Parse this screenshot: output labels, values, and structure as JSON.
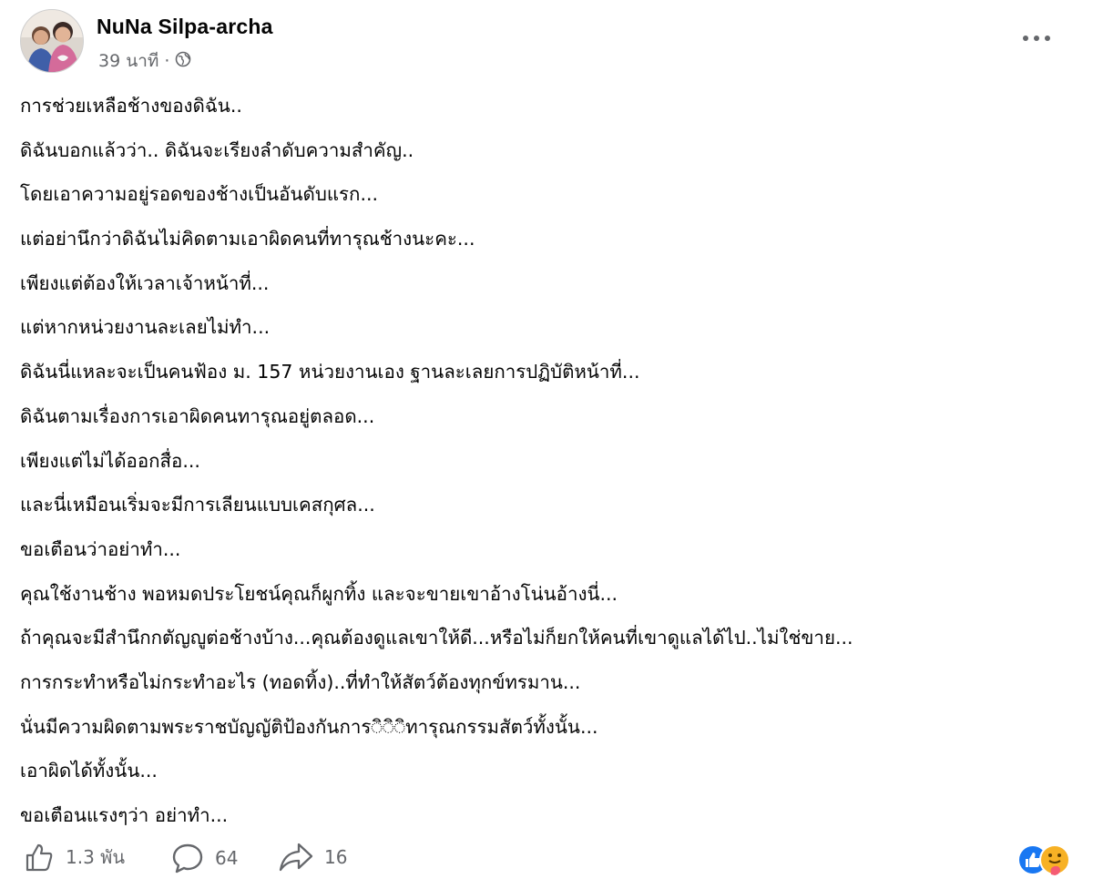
{
  "post": {
    "author": "NuNa Silpa-archa",
    "time": "39 นาที",
    "separator": "·",
    "privacy_icon": "globe-icon",
    "more_icon": "more-options-icon",
    "lines": [
      "การช่วยเหลือช้างของดิฉัน..",
      "ดิฉันบอกแล้วว่า.. ดิฉันจะเรียงลำดับความสำคัญ..",
      "โดยเอาความอยู่รอดของช้างเป็นอันดับแรก...",
      "แต่อย่านึกว่าดิฉันไม่คิดตามเอาผิดคนที่ทารุณช้างนะคะ...",
      "เพียงแต่ต้องให้เวลาเจ้าหน้าที่...",
      "แต่หากหน่วยงานละเลยไม่ทำ...",
      "ดิฉันนี่แหละจะเป็นคนฟ้อง ม. 157 หน่วยงานเอง ฐานละเลยการปฏิบัติหน้าที่...",
      "ดิฉันตามเรื่องการเอาผิดคนทารุณอยู่ตลอด...",
      "เพียงแต่ไม่ได้ออกสื่อ...",
      "และนี่เหมือนเริ่มจะมีการเลียนแบบเคสกุศล...",
      "ขอเตือนว่าอย่าทำ...",
      "คุณใช้งานช้าง พอหมดประโยชน์คุณก็ผูกทิ้ง และจะขายเขาอ้างโน่นอ้างนี่...",
      "ถ้าคุณจะมีสำนึกกตัญญูต่อช้างบ้าง...คุณต้องดูแลเขาให้ดี...หรือไม่ก็ยกให้คนที่เขาดูแลได้ไป..ไม่ใช่ขาย...",
      "การกระทำหรือไม่กระทำอะไร (ทอดทิ้ง)..ที่ทำให้สัตว์ต้องทุกข์ทรมาน...",
      "นั่นมีความผิดตามพระราชบัญญัติป้องกันการ◌ิ◌ิ◌ิทารุณกรรมสัตว์ทั้งนั้น...",
      "เอาผิดได้ทั้งนั้น...",
      "ขอเตือนแรงๆว่า อย่าทำ..."
    ]
  },
  "footer": {
    "like_icon": "thumbs-up-icon",
    "like_count": "1.3 พัน",
    "comment_icon": "comment-icon",
    "comment_count": "64",
    "share_icon": "share-icon",
    "share_count": "16",
    "reaction_icons": [
      "like-reaction-icon",
      "care-reaction-icon"
    ]
  },
  "colors": {
    "text": "#050505",
    "secondary": "#65676b",
    "like_blue": "#1877f2",
    "care_yellow": "#f7b125"
  }
}
